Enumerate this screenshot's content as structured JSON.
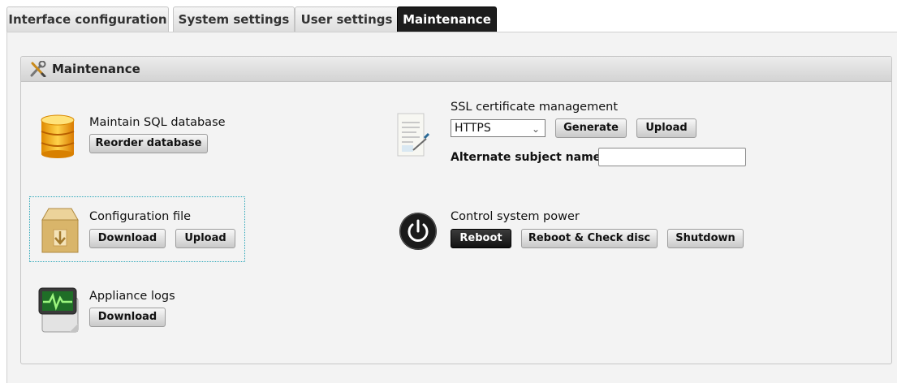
{
  "tabs": [
    {
      "label": "Interface configuration"
    },
    {
      "label": "System settings"
    },
    {
      "label": "User settings"
    },
    {
      "label": "Maintenance",
      "active": true
    }
  ],
  "panel": {
    "title": "Maintenance",
    "icon": "wrench-screwdriver-icon"
  },
  "sql": {
    "label": "Maintain SQL database",
    "reorder_button": "Reorder database",
    "icon": "database-icon"
  },
  "config": {
    "label": "Configuration file",
    "download_button": "Download",
    "upload_button": "Upload",
    "icon": "archive-box-icon"
  },
  "logs": {
    "label": "Appliance logs",
    "download_button": "Download",
    "icon": "monitor-log-icon"
  },
  "ssl": {
    "label": "SSL certificate management",
    "protocol_selected": "HTTPS",
    "generate_button": "Generate",
    "upload_button": "Upload",
    "alt_names_label": "Alternate subject names:",
    "alt_names_value": "",
    "icon": "certificate-document-icon"
  },
  "power": {
    "label": "Control system power",
    "reboot_button": "Reboot",
    "reboot_check_button": "Reboot & Check disc",
    "shutdown_button": "Shutdown",
    "icon": "power-icon"
  },
  "colors": {
    "active_tab_bg": "#1d1d1d",
    "focus_outline": "#2aa6b8"
  }
}
